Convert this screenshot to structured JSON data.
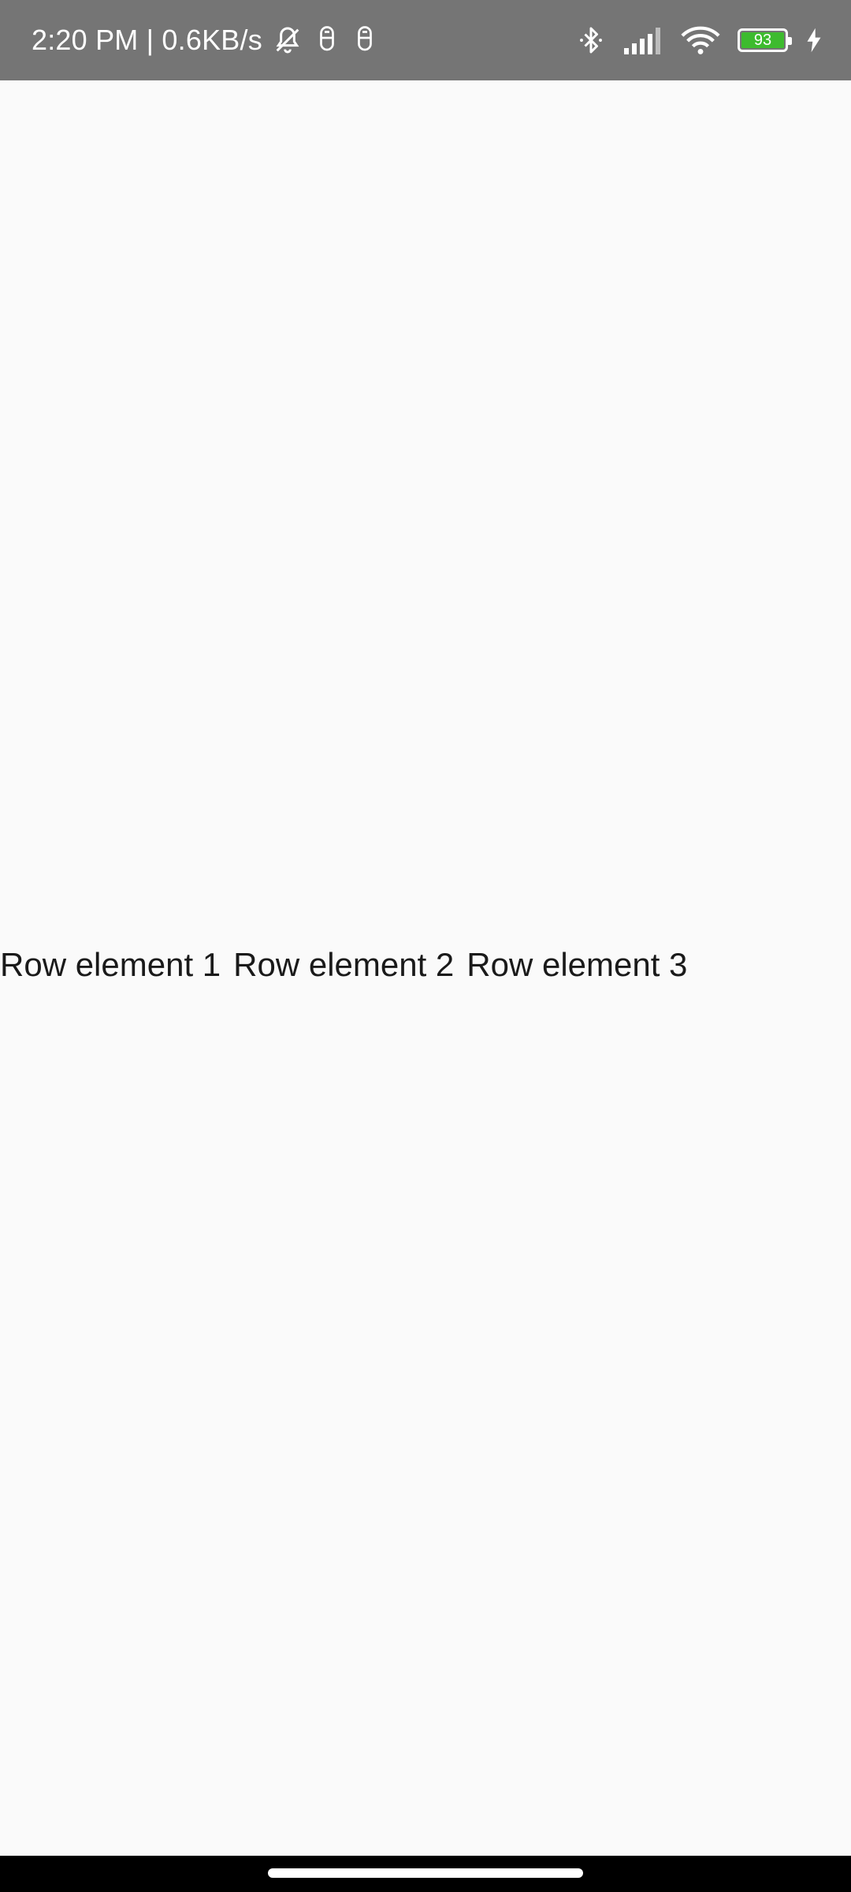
{
  "status_bar": {
    "time_speed": "2:20 PM | 0.6KB/s",
    "battery_level": "93",
    "icons": [
      "mute-bell-icon",
      "notification-app-icon",
      "notification-app-icon",
      "bluetooth-icon",
      "signal-icon",
      "wifi-icon",
      "battery-icon",
      "charging-icon"
    ],
    "background_color": "#757575",
    "battery_color": "#3dbb2e"
  },
  "main": {
    "row": [
      {
        "label": "Row element 1"
      },
      {
        "label": "Row element 2"
      },
      {
        "label": "Row element 3"
      }
    ]
  },
  "nav_bar": {
    "background_color": "#000000"
  }
}
